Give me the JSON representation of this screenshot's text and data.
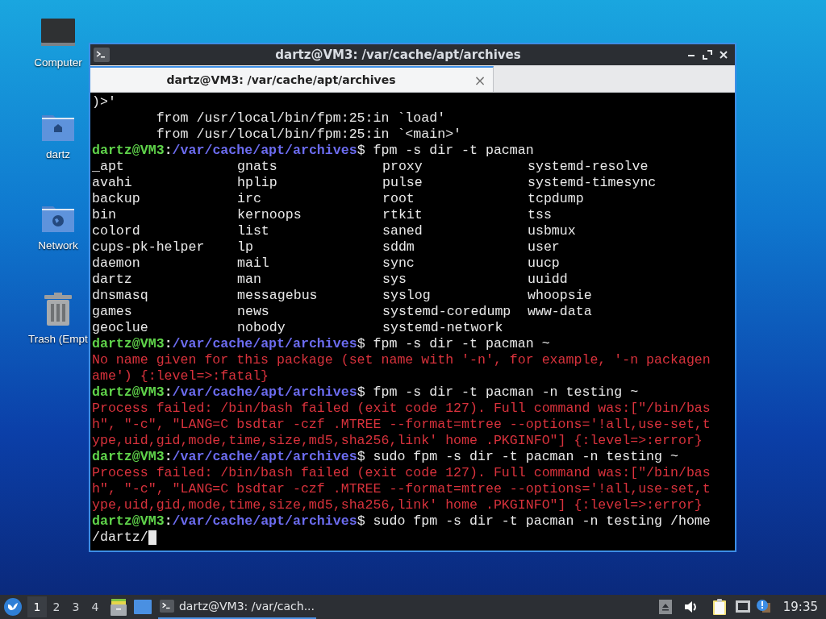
{
  "desktop_icons": [
    {
      "kind": "computer",
      "label": "Computer"
    },
    {
      "kind": "home",
      "label": "dartz"
    },
    {
      "kind": "network",
      "label": "Network"
    },
    {
      "kind": "trash",
      "label": "Trash (Empt"
    }
  ],
  "window": {
    "title": "dartz@VM3: /var/cache/apt/archives"
  },
  "tabs": [
    {
      "label": "dartz@VM3: /var/cache/apt/archives",
      "selected": true,
      "close": "×"
    }
  ],
  "terminal": {
    "lines": [
      {
        "kind": "output",
        "text": ")>'"
      },
      {
        "kind": "output",
        "text": "        from /usr/local/bin/fpm:25:in `load'"
      },
      {
        "kind": "output",
        "text": "        from /usr/local/bin/fpm:25:in `<main>'"
      },
      {
        "kind": "prompt",
        "user": "dartz@VM3",
        "separator": ":",
        "path": "/var/cache/apt/archives",
        "symbol": "$",
        "command": "fpm -s dir -t pacman"
      },
      {
        "kind": "columns",
        "cells": [
          "_apt",
          "gnats",
          "proxy",
          "systemd-resolve"
        ]
      },
      {
        "kind": "columns",
        "cells": [
          "avahi",
          "hplip",
          "pulse",
          "systemd-timesync"
        ]
      },
      {
        "kind": "columns",
        "cells": [
          "backup",
          "irc",
          "root",
          "tcpdump"
        ]
      },
      {
        "kind": "columns",
        "cells": [
          "bin",
          "kernoops",
          "rtkit",
          "tss"
        ]
      },
      {
        "kind": "columns",
        "cells": [
          "colord",
          "list",
          "saned",
          "usbmux"
        ]
      },
      {
        "kind": "columns",
        "cells": [
          "cups-pk-helper",
          "lp",
          "sddm",
          "user"
        ]
      },
      {
        "kind": "columns",
        "cells": [
          "daemon",
          "mail",
          "sync",
          "uucp"
        ]
      },
      {
        "kind": "columns",
        "cells": [
          "dartz",
          "man",
          "sys",
          "uuidd"
        ]
      },
      {
        "kind": "columns",
        "cells": [
          "dnsmasq",
          "messagebus",
          "syslog",
          "whoopsie"
        ]
      },
      {
        "kind": "columns",
        "cells": [
          "games",
          "news",
          "systemd-coredump",
          "www-data"
        ]
      },
      {
        "kind": "columns",
        "cells": [
          "geoclue",
          "nobody",
          "systemd-network"
        ]
      },
      {
        "kind": "prompt",
        "user": "dartz@VM3",
        "separator": ":",
        "path": "/var/cache/apt/archives",
        "symbol": "$",
        "command": "fpm -s dir -t pacman ~"
      },
      {
        "kind": "error",
        "text": "No name given for this package (set name with '-n', for example, '-n packagen"
      },
      {
        "kind": "error",
        "text": "ame') {:level=>:fatal}"
      },
      {
        "kind": "prompt",
        "user": "dartz@VM3",
        "separator": ":",
        "path": "/var/cache/apt/archives",
        "symbol": "$",
        "command": "fpm -s dir -t pacman -n testing ~"
      },
      {
        "kind": "error",
        "text": "Process failed: /bin/bash failed (exit code 127). Full command was:[\"/bin/bas"
      },
      {
        "kind": "error",
        "text": "h\", \"-c\", \"LANG=C bsdtar -czf .MTREE --format=mtree --options='!all,use-set,t"
      },
      {
        "kind": "error",
        "text": "ype,uid,gid,mode,time,size,md5,sha256,link' home .PKGINFO\"] {:level=>:error}"
      },
      {
        "kind": "prompt",
        "user": "dartz@VM3",
        "separator": ":",
        "path": "/var/cache/apt/archives",
        "symbol": "$",
        "command": "sudo fpm -s dir -t pacman -n testing ~"
      },
      {
        "kind": "error",
        "text": "Process failed: /bin/bash failed (exit code 127). Full command was:[\"/bin/bas"
      },
      {
        "kind": "error",
        "text": "h\", \"-c\", \"LANG=C bsdtar -czf .MTREE --format=mtree --options='!all,use-set,t"
      },
      {
        "kind": "error",
        "text": "ype,uid,gid,mode,time,size,md5,sha256,link' home .PKGINFO\"] {:level=>:error}"
      },
      {
        "kind": "prompt",
        "user": "dartz@VM3",
        "separator": ":",
        "path": "/var/cache/apt/archives",
        "symbol": "$",
        "command": "sudo fpm -s dir -t pacman -n testing /home"
      },
      {
        "kind": "output",
        "text": "/dartz/",
        "cursor": true
      }
    ]
  },
  "taskbar": {
    "workspaces": [
      {
        "label": "1",
        "selected": true
      },
      {
        "label": "2",
        "selected": false
      },
      {
        "label": "3",
        "selected": false
      },
      {
        "label": "4",
        "selected": false
      }
    ],
    "tasks": [
      {
        "label": "dartz@VM3: /var/cach...",
        "selected": true
      }
    ],
    "clock": "19:35"
  }
}
